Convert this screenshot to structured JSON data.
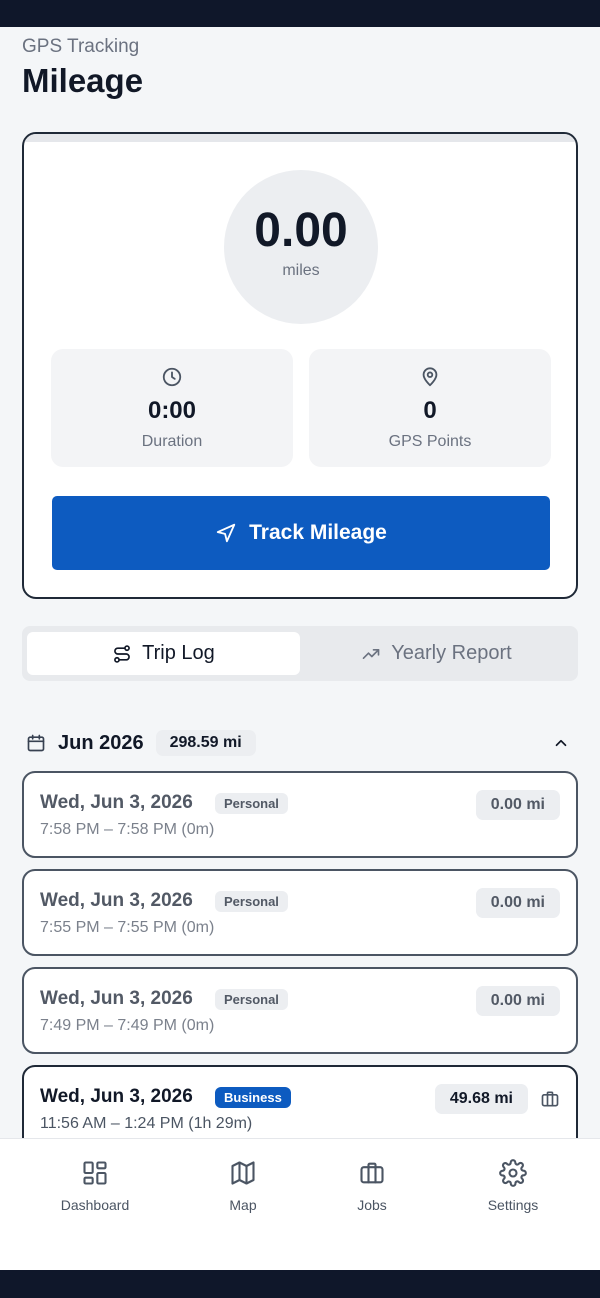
{
  "header": {
    "subtitle": "GPS Tracking",
    "title": "Mileage"
  },
  "tracker": {
    "miles_value": "0.00",
    "miles_unit": "miles",
    "duration_value": "0:00",
    "duration_label": "Duration",
    "gps_value": "0",
    "gps_label": "GPS Points",
    "button_label": "Track Mileage"
  },
  "tabs": {
    "trip_log": "Trip Log",
    "yearly_report": "Yearly Report"
  },
  "month": {
    "label": "Jun 2026",
    "total": "298.59 mi"
  },
  "trips": [
    {
      "date": "Wed, Jun 3, 2026",
      "type": "Personal",
      "time": "7:58 PM – 7:58 PM  (0m)",
      "distance": "0.00 mi"
    },
    {
      "date": "Wed, Jun 3, 2026",
      "type": "Personal",
      "time": "7:55 PM – 7:55 PM  (0m)",
      "distance": "0.00 mi"
    },
    {
      "date": "Wed, Jun 3, 2026",
      "type": "Personal",
      "time": "7:49 PM – 7:49 PM  (0m)",
      "distance": "0.00 mi"
    },
    {
      "date": "Wed, Jun 3, 2026",
      "type": "Business",
      "time": "11:56 AM – 1:24 PM  (1h 29m)",
      "distance": "49.68 mi"
    }
  ],
  "nav": [
    {
      "label": "Dashboard",
      "icon": "dashboard-icon"
    },
    {
      "label": "Map",
      "icon": "map-icon"
    },
    {
      "label": "Jobs",
      "icon": "briefcase-icon"
    },
    {
      "label": "Settings",
      "icon": "gear-icon"
    }
  ],
  "colors": {
    "primary": "#0d5bc0",
    "statusbar": "#0f172a"
  }
}
